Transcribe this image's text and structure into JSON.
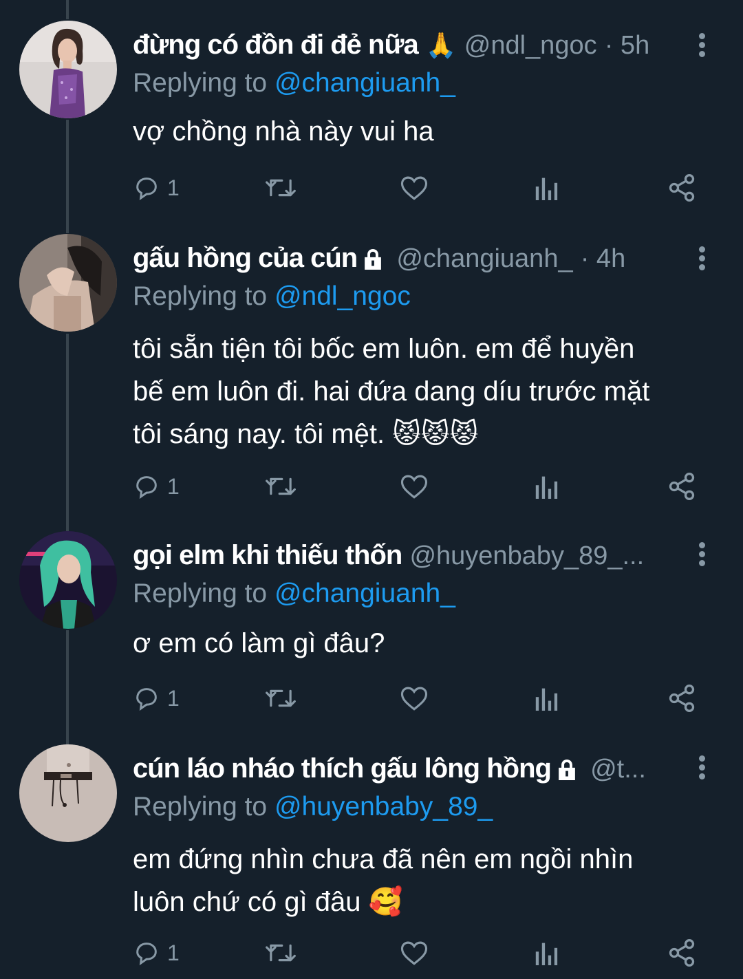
{
  "tweets": [
    {
      "name": "đừng có đồn đi đẻ nữa",
      "name_emoji": "🙏",
      "handle": "@ndl_ngoc",
      "time": "· 5h",
      "locked": false,
      "replying_label": "Replying to ",
      "replying_to": "@changiuanh_",
      "lines": [
        "vợ chồng nhà này vui ha"
      ],
      "reply_count": "1"
    },
    {
      "name": "gấu hồng của cún",
      "name_emoji": "",
      "handle": "@changiuanh_",
      "time": "· 4h",
      "locked": true,
      "replying_label": "Replying to ",
      "replying_to": "@ndl_ngoc",
      "lines": [
        "tôi sẵn tiện tôi bốc em luôn. em để huyền",
        "bế em luôn đi. hai đứa dang díu trước mặt",
        "tôi sáng nay. tôi mệt. 😾😾😾"
      ],
      "reply_count": "1"
    },
    {
      "name": "gọi elm khi thiếu thốn",
      "name_emoji": "",
      "handle": "@huyenbaby_89_...",
      "time": "",
      "locked": false,
      "replying_label": "Replying to ",
      "replying_to": "@changiuanh_",
      "lines": [
        "ơ em có làm gì đâu?"
      ],
      "reply_count": "1"
    },
    {
      "name": "cún láo nháo thích gấu lông hồng",
      "name_emoji": "",
      "handle": "@t...",
      "time": "",
      "locked": true,
      "replying_label": "Replying to ",
      "replying_to": "@huyenbaby_89_",
      "lines": [
        "em đứng nhìn chưa đã nên em ngồi nhìn",
        "luôn chứ có gì đâu 🥰"
      ],
      "reply_count": "1"
    }
  ],
  "icons": {
    "reply": "reply-icon",
    "retweet": "retweet-icon",
    "like": "heart-icon",
    "views": "analytics-icon",
    "share": "share-icon",
    "more": "more-vertical-icon",
    "lock": "lock-icon"
  },
  "colors": {
    "background": "#15202b",
    "text": "#ffffff",
    "secondary": "#8899a6",
    "link": "#1d9bf0",
    "thread_line": "#38444d"
  }
}
